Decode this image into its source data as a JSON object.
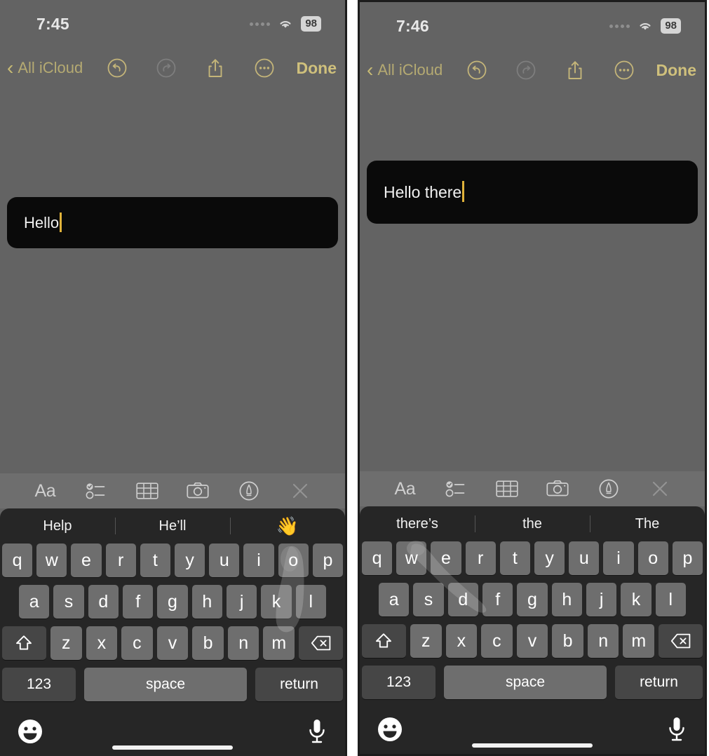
{
  "page": {
    "app": "Apple Notes",
    "panel_count": 2
  },
  "panels": [
    {
      "id": "left",
      "status": {
        "time": "7:45",
        "battery": "98",
        "wifi_icon": "wifi-icon",
        "cellular_dots_icon": "signal-dots-icon"
      },
      "nav": {
        "back_icon": "chevron-left-icon",
        "back_label": "All iCloud",
        "undo_icon": "undo-icon",
        "redo_icon": "redo-icon",
        "share_icon": "share-icon",
        "more_icon": "more-ellipsis-icon",
        "done_label": "Done"
      },
      "note": {
        "text": "Hello",
        "caret": true
      },
      "format_toolbar": {
        "text_format_label": "Aa",
        "text_format_icon": "text-format-icon",
        "checklist_icon": "checklist-icon",
        "table_icon": "table-icon",
        "camera_icon": "camera-icon",
        "markup_icon": "markup-pen-icon",
        "close_icon": "close-icon"
      },
      "suggestions": [
        "Help",
        "He’ll",
        "👋"
      ],
      "keyboard": {
        "row1": [
          "q",
          "w",
          "e",
          "r",
          "t",
          "y",
          "u",
          "i",
          "o",
          "p"
        ],
        "row2": [
          "a",
          "s",
          "d",
          "f",
          "g",
          "h",
          "j",
          "k",
          "l"
        ],
        "row3": [
          "z",
          "x",
          "c",
          "v",
          "b",
          "n",
          "m"
        ],
        "shift_icon": "shift-icon",
        "delete_icon": "delete-backspace-icon",
        "numbers_label": "123",
        "space_label": "space",
        "return_label": "return",
        "emoji_icon": "emoji-smiley-icon",
        "mic_icon": "microphone-icon"
      },
      "gesture": {
        "type": "tap",
        "target_key": "o"
      }
    },
    {
      "id": "right",
      "status": {
        "time": "7:46",
        "battery": "98",
        "wifi_icon": "wifi-icon",
        "cellular_dots_icon": "signal-dots-icon"
      },
      "nav": {
        "back_icon": "chevron-left-icon",
        "back_label": "All iCloud",
        "undo_icon": "undo-icon",
        "redo_icon": "redo-icon",
        "share_icon": "share-icon",
        "more_icon": "more-ellipsis-icon",
        "done_label": "Done"
      },
      "note": {
        "text": "Hello there",
        "caret": true
      },
      "format_toolbar": {
        "text_format_label": "Aa",
        "text_format_icon": "text-format-icon",
        "checklist_icon": "checklist-icon",
        "table_icon": "table-icon",
        "camera_icon": "camera-icon",
        "markup_icon": "markup-pen-icon",
        "close_icon": "close-icon"
      },
      "suggestions": [
        "there’s",
        "the",
        "The"
      ],
      "keyboard": {
        "row1": [
          "q",
          "w",
          "e",
          "r",
          "t",
          "y",
          "u",
          "i",
          "o",
          "p"
        ],
        "row2": [
          "a",
          "s",
          "d",
          "f",
          "g",
          "h",
          "j",
          "k",
          "l"
        ],
        "row3": [
          "z",
          "x",
          "c",
          "v",
          "b",
          "n",
          "m"
        ],
        "shift_icon": "shift-icon",
        "delete_icon": "delete-backspace-icon",
        "numbers_label": "123",
        "space_label": "space",
        "return_label": "return",
        "emoji_icon": "emoji-smiley-icon",
        "mic_icon": "microphone-icon"
      },
      "gesture": {
        "type": "swipe",
        "target_key": "e"
      }
    }
  ],
  "colors": {
    "accent_gold": "#cfc07c",
    "accent_gold_muted": "#b5aa72",
    "note_background": "#0a0a0a",
    "page_background": "#636363",
    "keyboard_background": "#262626",
    "key_fill": "#6e6e6e",
    "key_mod_fill": "#464646",
    "caret": "#e0b23a"
  }
}
